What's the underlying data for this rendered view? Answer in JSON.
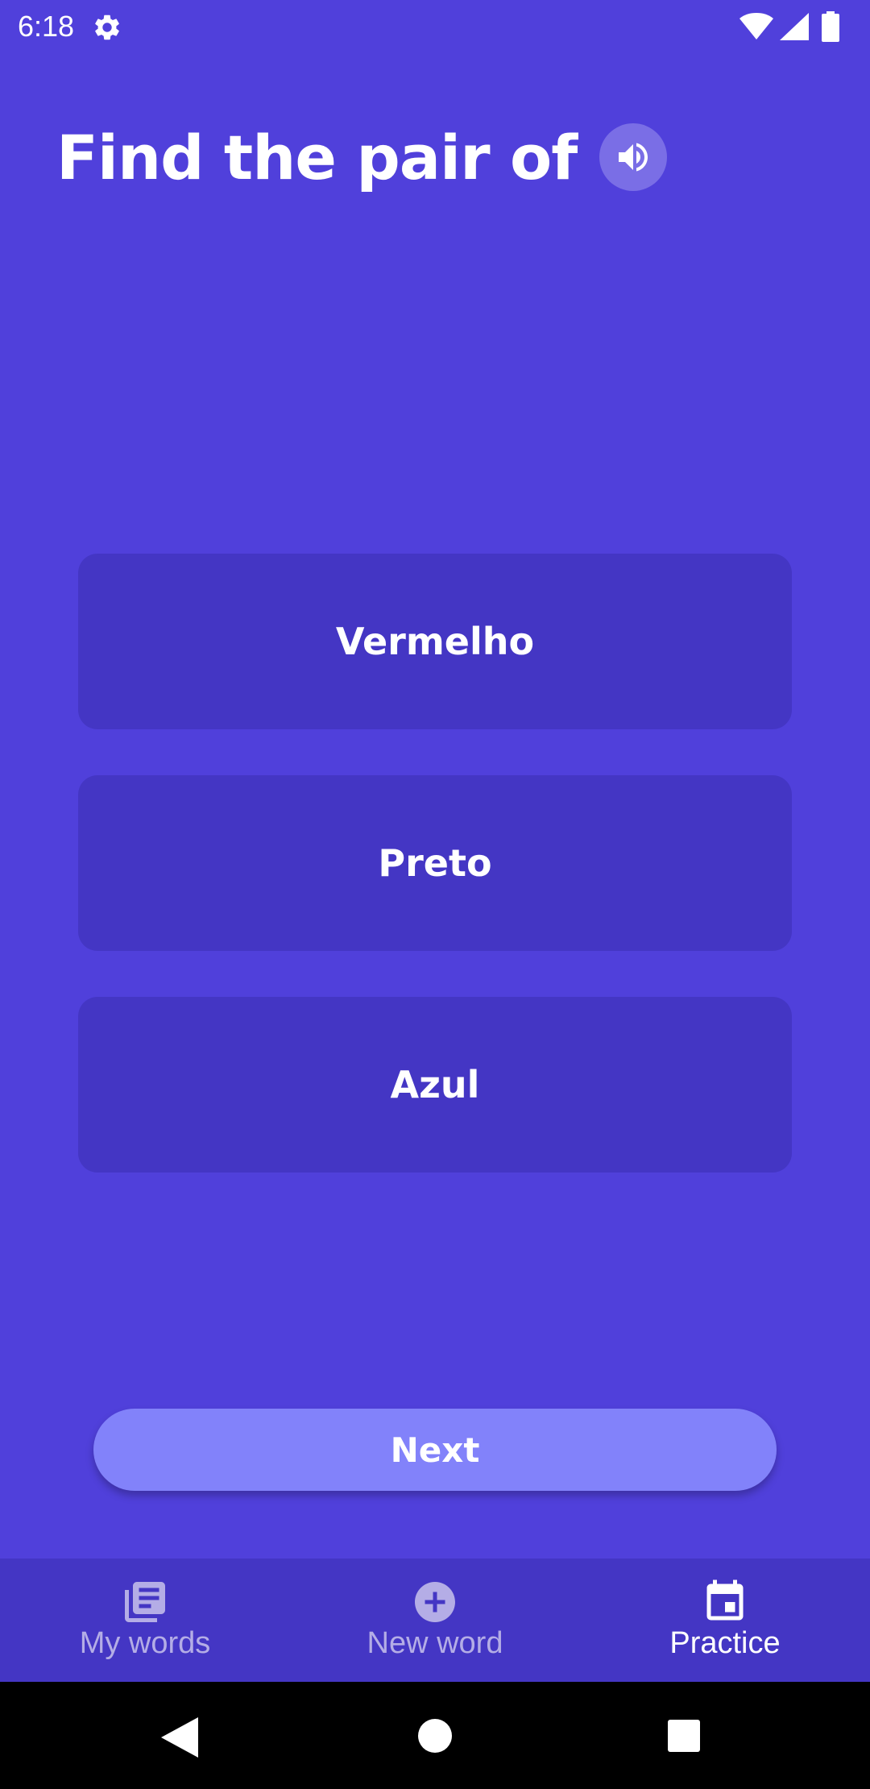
{
  "status_bar": {
    "time": "6:18",
    "icons": [
      "settings-gear-icon",
      "wifi-icon",
      "cellular-signal-icon",
      "battery-icon"
    ]
  },
  "prompt": {
    "title": "Find the pair of",
    "audio_icon": "speaker-volume-icon"
  },
  "options": [
    {
      "label": "Vermelho"
    },
    {
      "label": "Preto"
    },
    {
      "label": "Azul"
    }
  ],
  "actions": {
    "next_label": "Next"
  },
  "bottom_nav": {
    "items": [
      {
        "label": "My words",
        "icon": "library-books-icon",
        "active": false
      },
      {
        "label": "New word",
        "icon": "add-circle-icon",
        "active": false
      },
      {
        "label": "Practice",
        "icon": "calendar-icon",
        "active": true
      }
    ]
  },
  "colors": {
    "background": "#5040db",
    "option_card": "#4436c4",
    "next_button": "#8282fa",
    "speaker_button": "#7a6ee6",
    "nav_bar": "#4436c4",
    "nav_inactive": "#b4ade6",
    "nav_active": "#ffffff"
  }
}
